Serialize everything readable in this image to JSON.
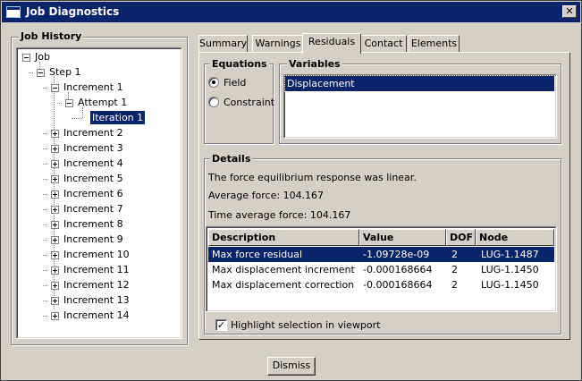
{
  "window": {
    "title": "Job Diagnostics",
    "close_glyph": "✕"
  },
  "job_history": {
    "label": "Job History",
    "tree": [
      {
        "label": "Job",
        "expanded": true
      },
      {
        "label": "Step 1",
        "expanded": true
      },
      {
        "label": "Increment 1",
        "expanded": true
      },
      {
        "label": "Attempt 1",
        "expanded": true
      },
      {
        "label": "Iteration 1",
        "selected": true
      },
      {
        "label": "Increment 2"
      },
      {
        "label": "Increment 3"
      },
      {
        "label": "Increment 4"
      },
      {
        "label": "Increment 5"
      },
      {
        "label": "Increment 6"
      },
      {
        "label": "Increment 7"
      },
      {
        "label": "Increment 8"
      },
      {
        "label": "Increment 9"
      },
      {
        "label": "Increment 10"
      },
      {
        "label": "Increment 11"
      },
      {
        "label": "Increment 12"
      },
      {
        "label": "Increment 13"
      },
      {
        "label": "Increment 14"
      }
    ]
  },
  "tabs": [
    {
      "label": "Summary"
    },
    {
      "label": "Warnings"
    },
    {
      "label": "Residuals",
      "active": true
    },
    {
      "label": "Contact"
    },
    {
      "label": "Elements"
    }
  ],
  "equations": {
    "label": "Equations",
    "options": [
      {
        "label": "Field",
        "checked": true
      },
      {
        "label": "Constraint",
        "checked": false
      }
    ]
  },
  "variables": {
    "label": "Variables",
    "items": [
      {
        "label": "Displacement",
        "selected": true
      }
    ]
  },
  "details": {
    "label": "Details",
    "lines": [
      "The force equilibrium response was linear.",
      "Average force: 104.167",
      "Time average force: 104.167"
    ],
    "table": {
      "columns": [
        "Description",
        "Value",
        "DOF",
        "Node"
      ],
      "rows": [
        {
          "description": "Max force residual",
          "value": "-1.09728e-09",
          "dof": "2",
          "node": "LUG-1.1487",
          "selected": true
        },
        {
          "description": "Max displacement increment",
          "value": "-0.000168664",
          "dof": "2",
          "node": "LUG-1.1450"
        },
        {
          "description": "Max displacement correction",
          "value": "-0.000168664",
          "dof": "2",
          "node": "LUG-1.1450"
        }
      ]
    },
    "highlight": {
      "label": "Highlight selection in viewport",
      "checked": true,
      "check_glyph": "✓"
    }
  },
  "footer": {
    "dismiss_label": "Dismiss"
  },
  "colors": {
    "selection": "#0a246a",
    "face": "#d4d0c8"
  }
}
